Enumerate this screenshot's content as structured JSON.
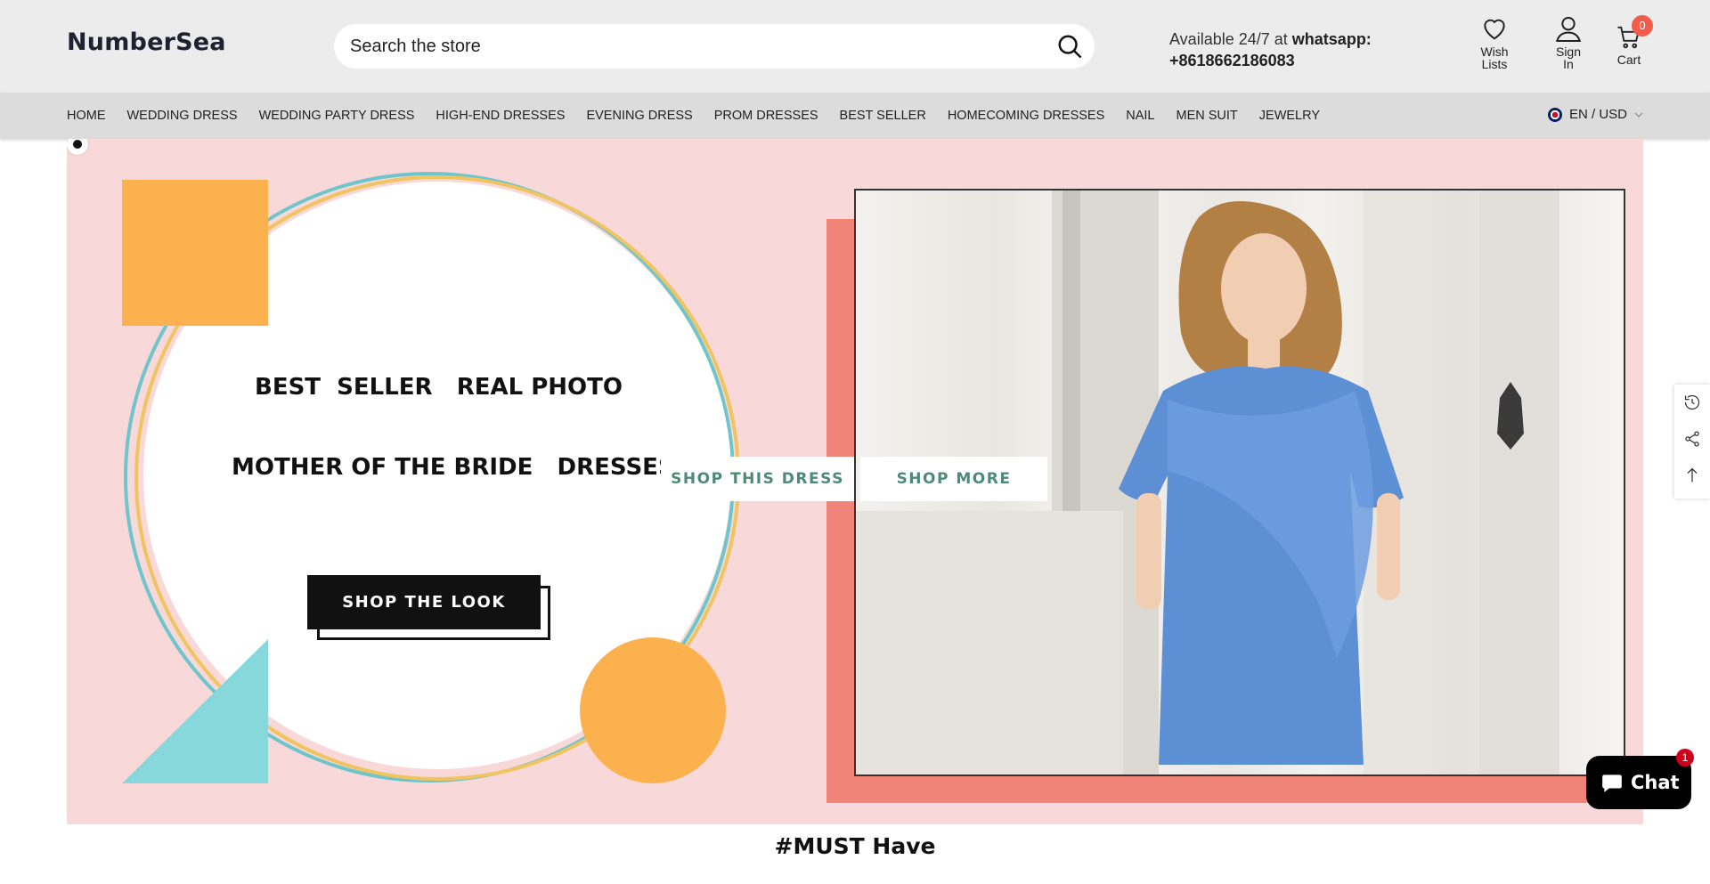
{
  "header": {
    "logo": "NumberSea",
    "search_placeholder": "Search the store",
    "contact_prefix": "Available 24/7 at",
    "contact_label": "whatsapp:",
    "contact_phone": "+8618662186083",
    "wishlist_line1": "Wish",
    "wishlist_line2": "Lists",
    "signin_line1": "Sign",
    "signin_line2": "In",
    "cart_label": "Cart",
    "cart_count": "0"
  },
  "nav": {
    "items": [
      "HOME",
      "WEDDING DRESS",
      "WEDDING PARTY DRESS",
      "HIGH-END DRESSES",
      "EVENING DRESS",
      "PROM DRESSES",
      "BEST SELLER",
      "HOMECOMING DRESSES",
      "NAIL",
      "MEN SUIT",
      "JEWELRY"
    ],
    "locale": "EN / USD"
  },
  "hero": {
    "headline1": "BEST  SELLER   REAL PHOTO",
    "headline2": "MOTHER OF THE BRIDE   DRESSES",
    "shop_look": "SHOP THE LOOK",
    "shop_dress": "SHOP THIS DRESS",
    "shop_more": "SHOP MORE",
    "colors": {
      "background": "#f8d8d8",
      "accent_orange": "#fbb24e",
      "accent_teal": "#86d8da",
      "salmon": "#f08478",
      "dress_blue": "#5d8fd4",
      "button_text": "#4e8a78"
    }
  },
  "section": {
    "title": "#MUST Have"
  },
  "chat": {
    "label": "Chat",
    "badge": "1"
  },
  "icons": [
    "search-icon",
    "heart-icon",
    "user-icon",
    "cart-icon",
    "flag-icon",
    "chevron-down-icon",
    "history-icon",
    "share-icon",
    "arrow-up-icon",
    "chat-bubble-icon"
  ]
}
